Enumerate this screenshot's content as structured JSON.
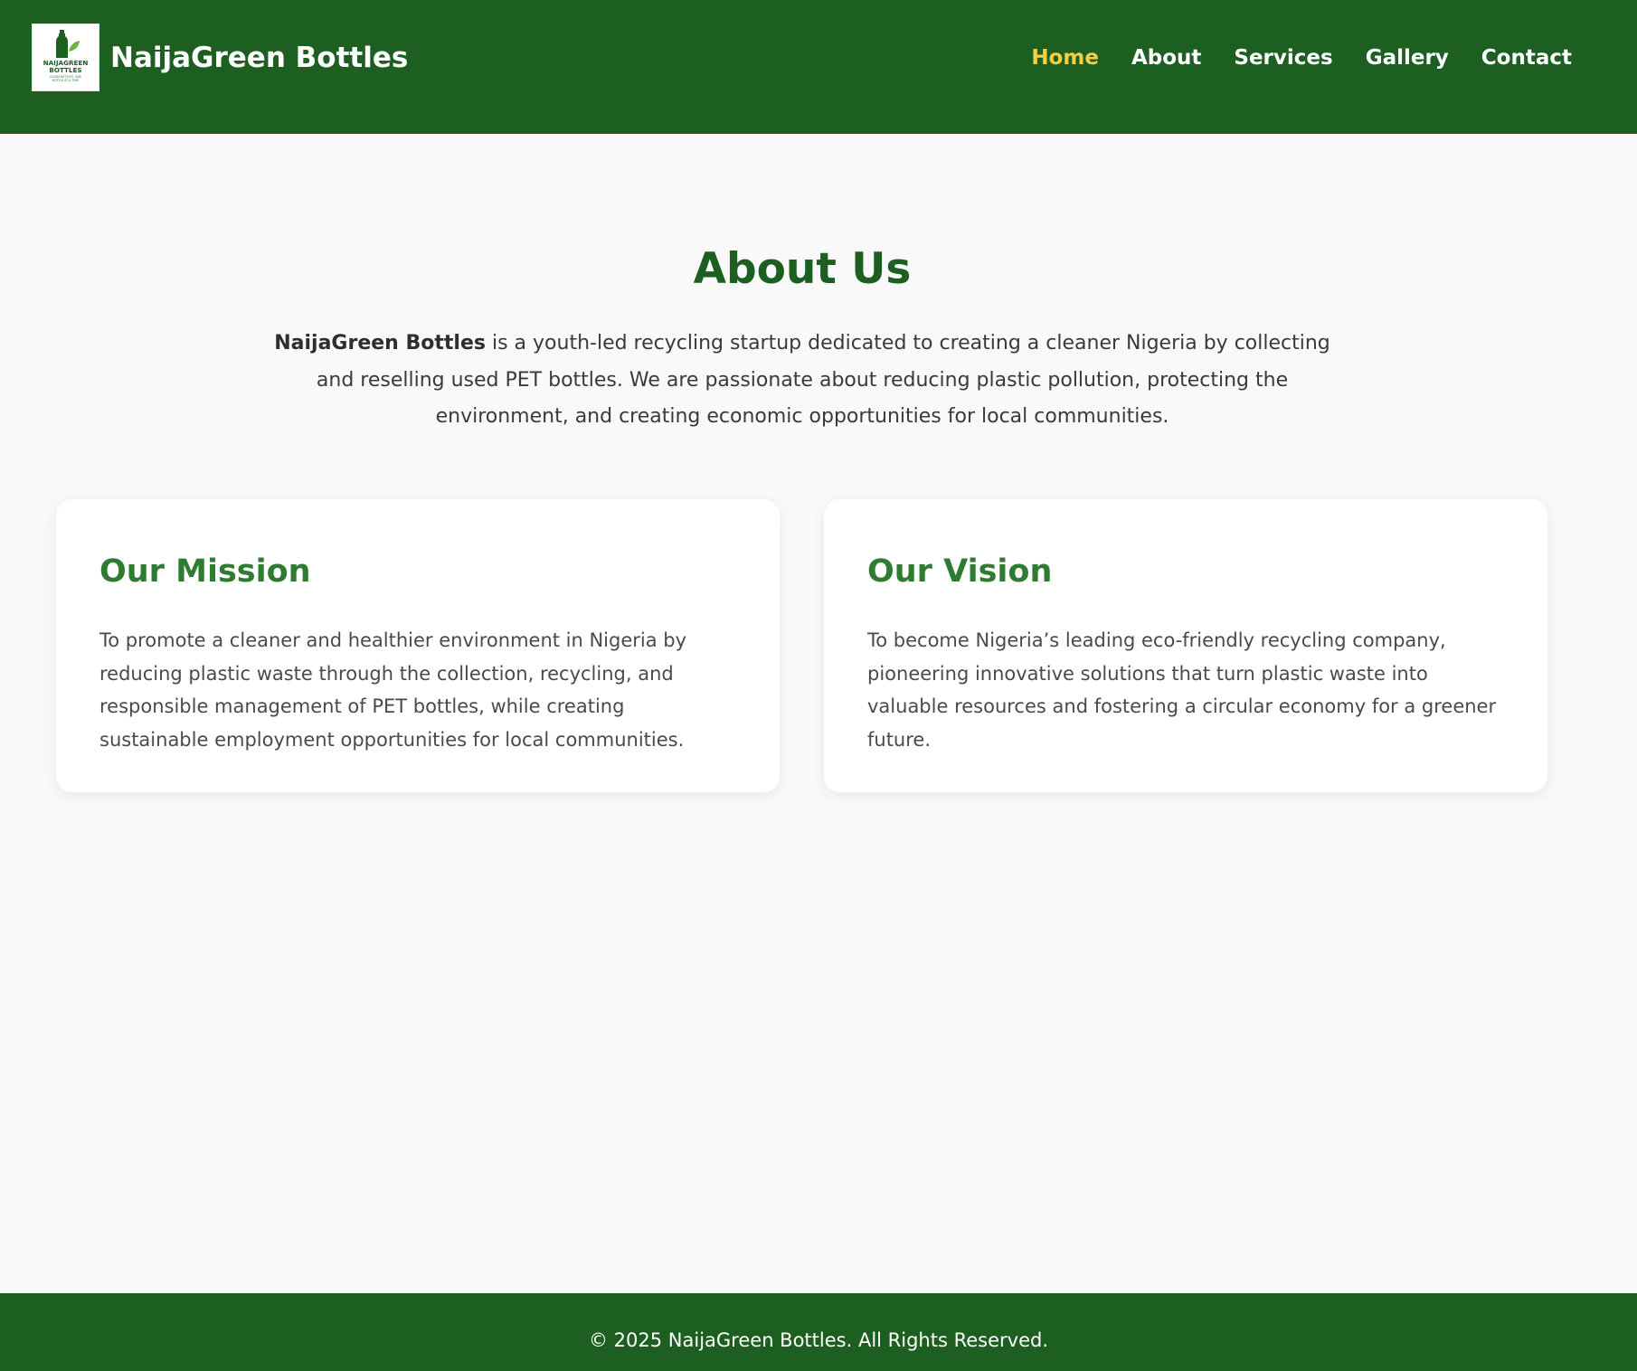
{
  "header": {
    "brand": "NaijaGreen Bottles",
    "logo": {
      "line1": "NAIJAGREEN",
      "line2": "BOTTLES",
      "tagline1": "CLEAN BOTTLES, ONE",
      "tagline2": "BOTTLE AT A TIME",
      "icons": [
        "bottle-icon",
        "leaf-icon"
      ]
    },
    "nav": [
      {
        "label": "Home",
        "active": true
      },
      {
        "label": "About",
        "active": false
      },
      {
        "label": "Services",
        "active": false
      },
      {
        "label": "Gallery",
        "active": false
      },
      {
        "label": "Contact",
        "active": false
      }
    ]
  },
  "about": {
    "title": "About Us",
    "intro_brand": "NaijaGreen Bottles",
    "intro_text": " is a youth-led recycling startup dedicated to creating a cleaner Nigeria by collecting and reselling used PET bottles. We are passionate about reducing plastic pollution, protecting the environment, and creating economic opportunities for local communities."
  },
  "cards": [
    {
      "title": "Our Mission",
      "text": "To promote a cleaner and healthier environment in Nigeria by reducing plastic waste through the collection, recycling, and responsible management of PET bottles, while creating sustainable employment opportunities for local communities."
    },
    {
      "title": "Our Vision",
      "text": "To become Nigeria’s leading eco-friendly recycling company, pioneering innovative solutions that turn plastic waste into valuable resources and fostering a circular economy for a greener future."
    }
  ],
  "footer": {
    "text": "© 2025 NaijaGreen Bottles. All Rights Reserved."
  },
  "colors": {
    "primary_green": "#1d5e21",
    "card_heading_green": "#2f7b32",
    "active_nav": "#f4cf45",
    "background": "#f9f9f9"
  }
}
